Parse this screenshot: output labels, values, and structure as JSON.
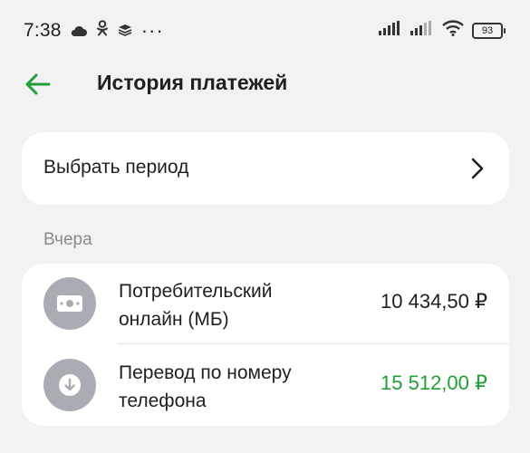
{
  "status_bar": {
    "time": "7:38",
    "ellipsis": "···",
    "battery": "93",
    "icons": [
      "cloud-icon",
      "odnoklassniki-icon",
      "layers-icon",
      "signal-icon",
      "signal-icon",
      "wifi-icon",
      "battery-icon"
    ]
  },
  "header": {
    "title": "История платежей",
    "back_icon": "arrow-left-icon"
  },
  "period": {
    "label": "Выбрать период",
    "icon": "chevron-right-icon"
  },
  "section": {
    "label": "Вчера"
  },
  "payments": [
    {
      "name": "Потребительский онлайн (МБ)",
      "amount": "10 434,50 ₽",
      "amount_color": "#1f1f1f",
      "icon": "cash-icon"
    },
    {
      "name": "Перевод по номеру телефона",
      "amount": "15 512,00 ₽",
      "amount_color": "#21a038",
      "icon": "arrow-down-circle-icon"
    }
  ],
  "colors": {
    "accent": "#21a038",
    "background": "#f2f2f2",
    "card": "#ffffff",
    "icon_bg": "#a9adb3"
  }
}
